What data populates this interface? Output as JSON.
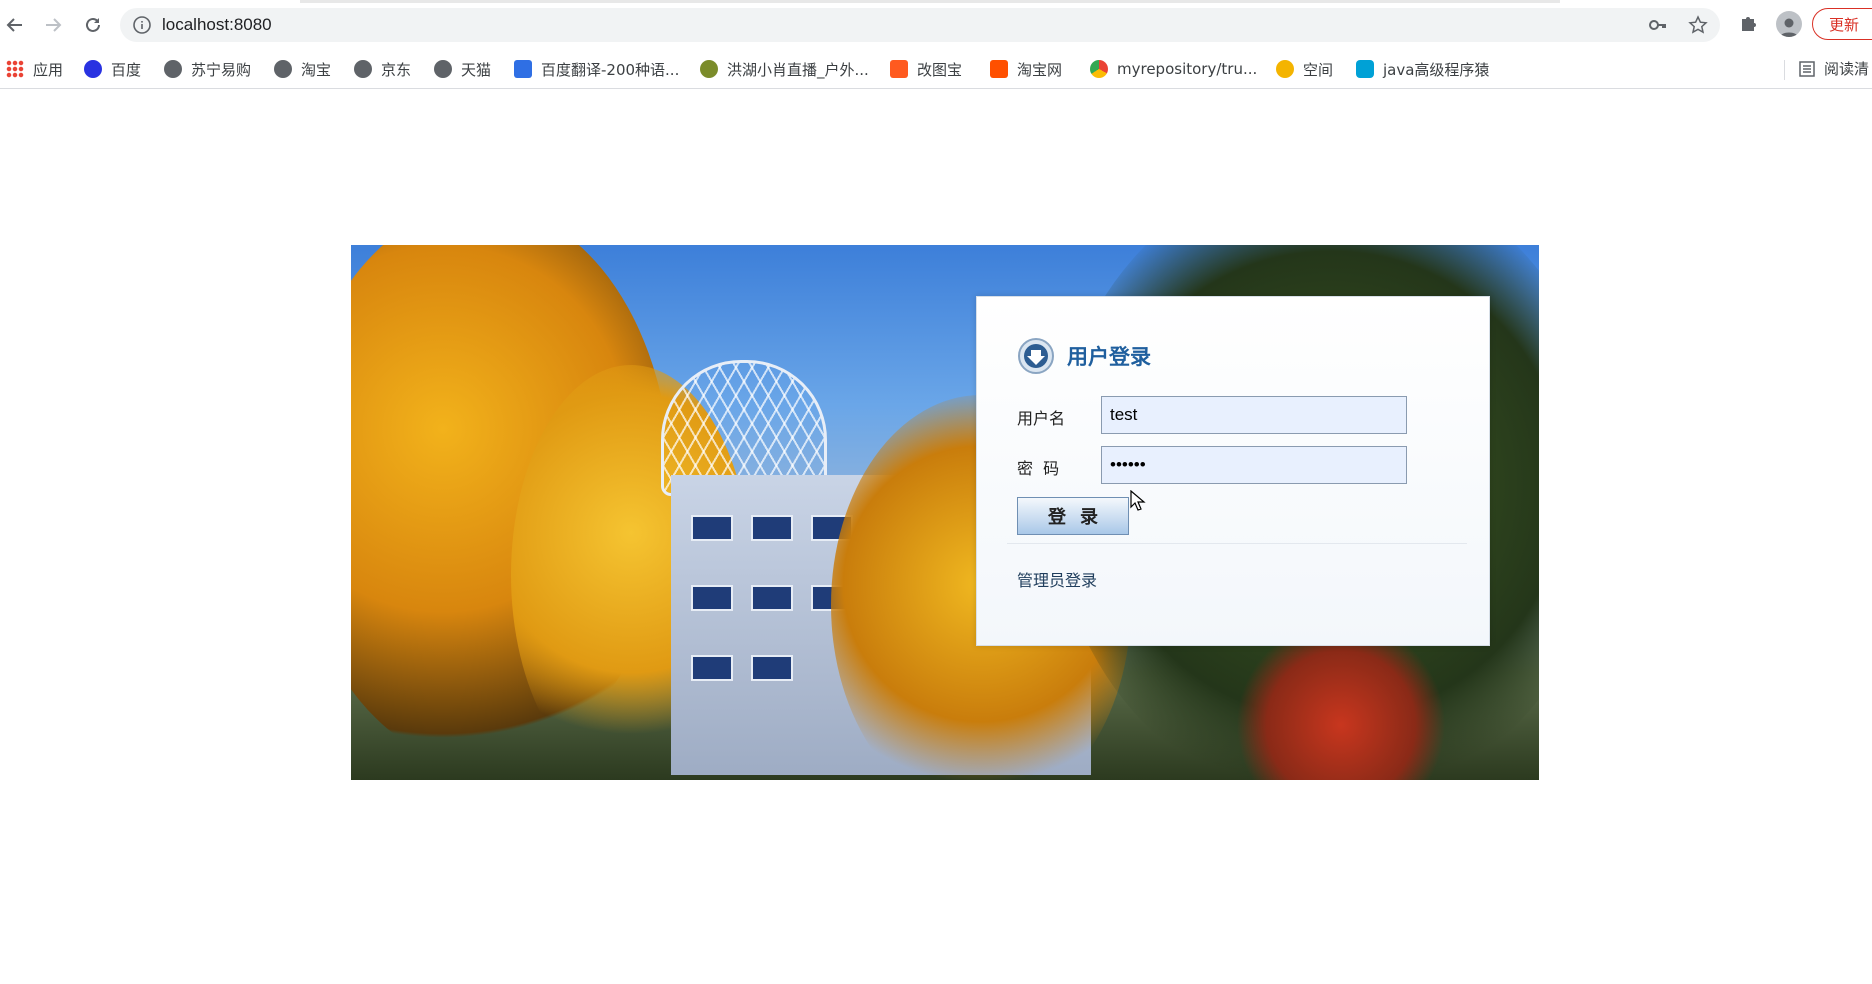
{
  "browser": {
    "url": "localhost:8080",
    "update_label": "更新"
  },
  "bookmarks": [
    {
      "label": "应用",
      "icon": "apps-grid-icon",
      "color": "#ea4335"
    },
    {
      "label": "百度",
      "icon": "baidu-paw-icon",
      "color": "#2932e1"
    },
    {
      "label": "苏宁易购",
      "icon": "globe-icon",
      "color": "#5f6368"
    },
    {
      "label": "淘宝",
      "icon": "globe-icon",
      "color": "#5f6368"
    },
    {
      "label": "京东",
      "icon": "globe-icon",
      "color": "#5f6368"
    },
    {
      "label": "天猫",
      "icon": "globe-icon",
      "color": "#5f6368"
    },
    {
      "label": "百度翻译-200种语...",
      "icon": "translate-icon",
      "color": "#2f6fe4"
    },
    {
      "label": "洪湖小肖直播_户外...",
      "icon": "bird-icon",
      "color": "#7b8c2a"
    },
    {
      "label": "改图宝",
      "icon": "gaitubao-icon",
      "color": "#ff5a1f"
    },
    {
      "label": "淘宝网",
      "icon": "taobao-icon",
      "color": "#ff5000"
    },
    {
      "label": "myrepository/tru...",
      "icon": "chrome-icon",
      "color": "#34a853"
    },
    {
      "label": "空间",
      "icon": "qzone-icon",
      "color": "#f4b400"
    },
    {
      "label": "java高级程序猿",
      "icon": "bilibili-icon",
      "color": "#00a1d6"
    }
  ],
  "reading_list": "阅读清",
  "login": {
    "title": "用户登录",
    "username_label": "用户名",
    "username_value": "test",
    "password_label": "密  码",
    "password_value": "••••••",
    "submit_label": "登录",
    "admin_link": "管理员登录"
  }
}
